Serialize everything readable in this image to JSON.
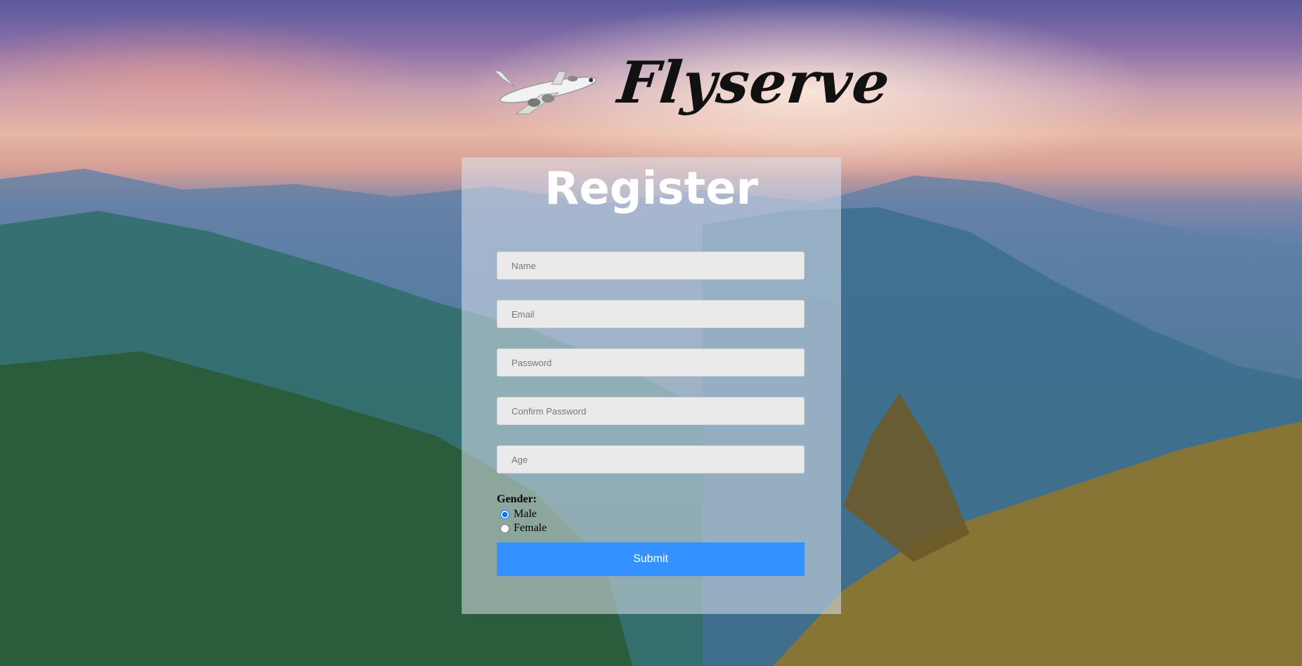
{
  "brand": {
    "name": "Flyserve"
  },
  "form": {
    "title": "Register",
    "fields": {
      "name": {
        "placeholder": "Name",
        "value": ""
      },
      "email": {
        "placeholder": "Email",
        "value": ""
      },
      "password": {
        "placeholder": "Password",
        "value": ""
      },
      "confirm_password": {
        "placeholder": "Confirm Password",
        "value": ""
      },
      "age": {
        "placeholder": "Age",
        "value": ""
      }
    },
    "gender": {
      "label": "Gender:",
      "options": [
        {
          "label": "Male",
          "checked": true
        },
        {
          "label": "Female",
          "checked": false
        }
      ]
    },
    "submit_label": "Submit"
  },
  "colors": {
    "submit": "#3392ff",
    "panel": "rgba(220,226,238,0.55)"
  }
}
